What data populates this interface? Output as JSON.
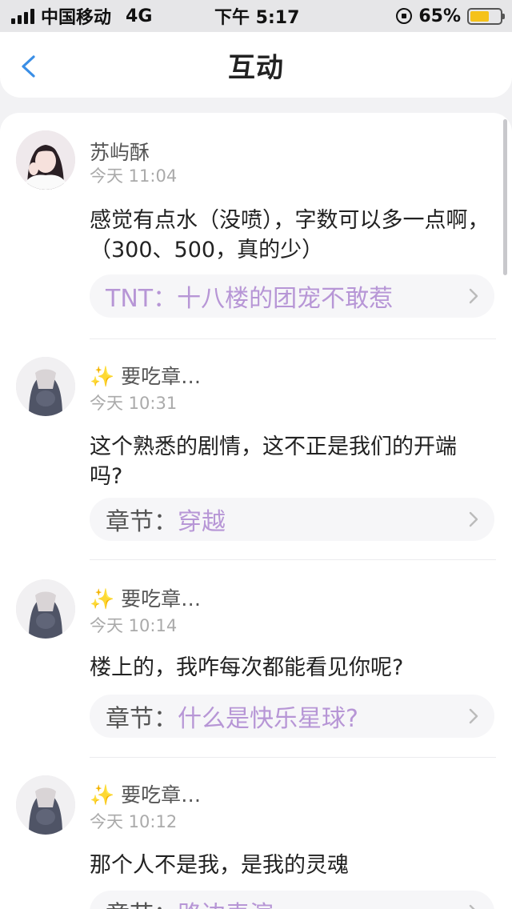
{
  "status_bar": {
    "carrier": "中国移动",
    "network": "4G",
    "time": "下午 5:17",
    "battery": "65%",
    "battery_level": 0.65,
    "icons": [
      "signal-icon",
      "orientation-lock-icon",
      "battery-icon"
    ]
  },
  "header": {
    "title": "互动",
    "back_icon": "chevron-left-icon"
  },
  "colors": {
    "accent_purple": "#b796d6",
    "back_blue": "#3a8ee6",
    "battery_yellow": "#f5c21b"
  },
  "comments": [
    {
      "username": "苏屿酥",
      "time": "今天 11:04",
      "text": "感觉有点水（没喷），字数可以多一点啊，（300、500，真的少）",
      "link_prefix": "TNT：",
      "link_title": "十八楼的团宠不敢惹"
    },
    {
      "username_emoji": "✨",
      "username": "要吃章…",
      "time": "今天 10:31",
      "text": "这个熟悉的剧情，这不正是我们的开端吗?",
      "link_prefix": "章节：",
      "link_title": "穿越"
    },
    {
      "username_emoji": "✨",
      "username": "要吃章…",
      "time": "今天 10:14",
      "text": "楼上的，我咋每次都能看见你呢?",
      "link_prefix": "章节：",
      "link_title": "什么是快乐星球?"
    },
    {
      "username_emoji": "✨",
      "username": "要吃章…",
      "time": "今天 10:12",
      "text": "那个人不是我，是我的灵魂",
      "link_prefix": "章节：",
      "link_title": "路边表演"
    }
  ]
}
